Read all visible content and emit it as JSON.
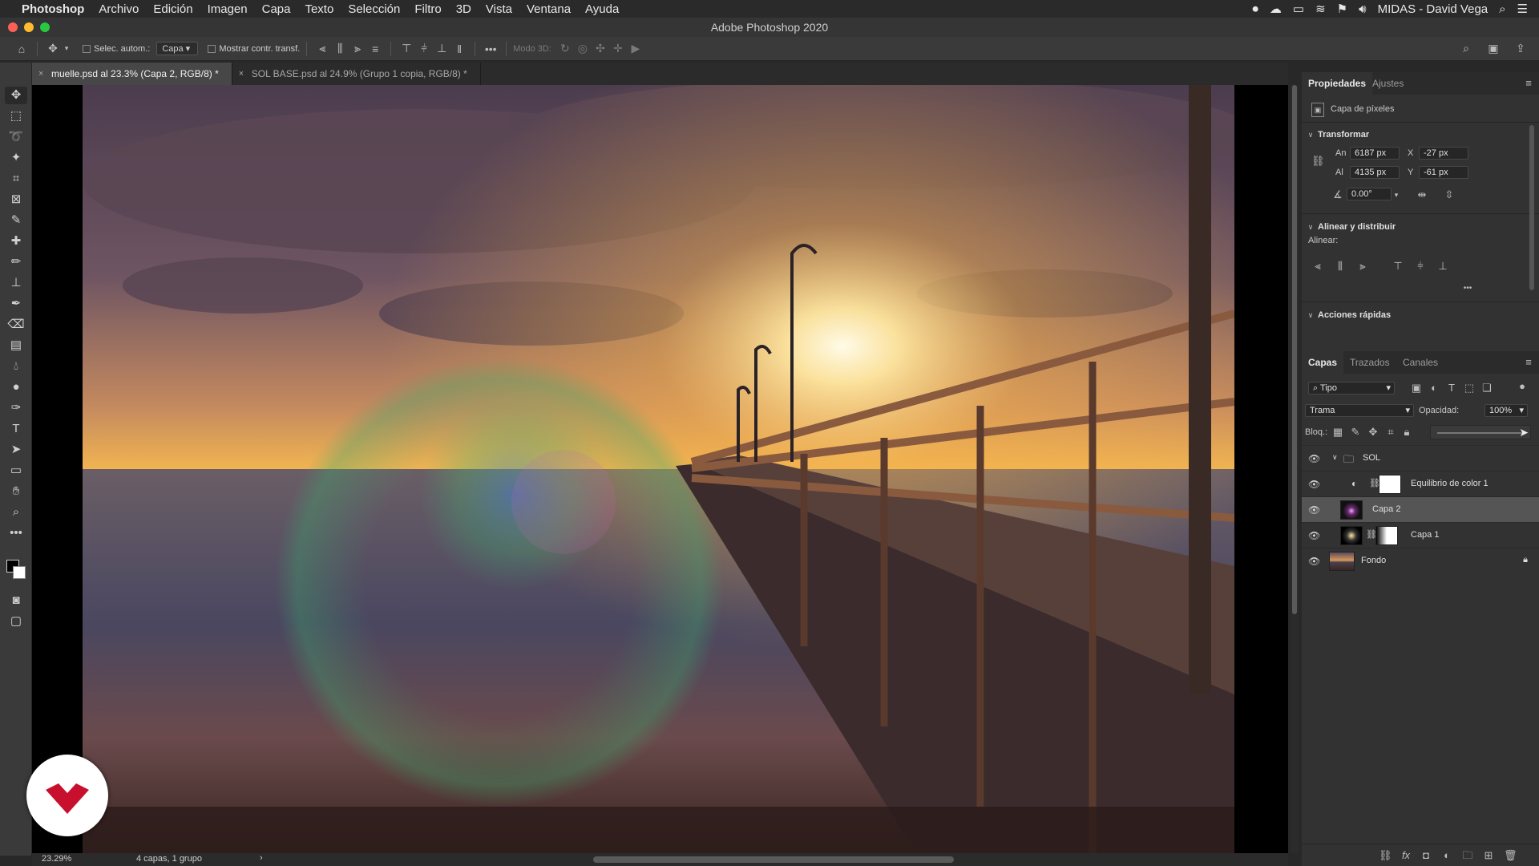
{
  "menubar": {
    "apple_icon": "apple-icon",
    "app_name": "Photoshop",
    "items": [
      "Archivo",
      "Edición",
      "Imagen",
      "Capa",
      "Texto",
      "Selección",
      "Filtro",
      "3D",
      "Vista",
      "Ventana",
      "Ayuda"
    ],
    "user": "MIDAS - David Vega"
  },
  "window": {
    "title": "Adobe Photoshop 2020"
  },
  "options_bar": {
    "auto_select_label": "Selec. autom.:",
    "auto_select_value": "Capa",
    "show_transform_label": "Mostrar contr. transf.",
    "mode3d_label": "Modo 3D:",
    "more": "•••"
  },
  "tabs": [
    {
      "close": "×",
      "label": "muelle.psd al 23.3% (Capa 2, RGB/8) *",
      "active": true
    },
    {
      "close": "×",
      "label": "SOL BASE.psd al 24.9% (Grupo 1 copia, RGB/8) *",
      "active": false
    }
  ],
  "status": {
    "zoom": "23.29%",
    "info": "4 capas, 1 grupo",
    "arrow": "›"
  },
  "properties": {
    "tab_props": "Propiedades",
    "tab_adjust": "Ajustes",
    "layer_type": "Capa de píxeles",
    "transform_title": "Transformar",
    "w_label": "An",
    "w_value": "6187 px",
    "h_label": "Al",
    "h_value": "4135 px",
    "x_label": "X",
    "x_value": "-27 px",
    "y_label": "Y",
    "y_value": "-61 px",
    "angle_value": "0.00°",
    "align_title": "Alinear y distribuir",
    "align_label": "Alinear:",
    "more": "•••",
    "quick_title": "Acciones rápidas"
  },
  "layers_panel": {
    "tab_layers": "Capas",
    "tab_paths": "Trazados",
    "tab_channels": "Canales",
    "filter_value": "Tipo",
    "blend_mode": "Trama",
    "opacity_label": "Opacidad:",
    "opacity_value": "100%",
    "lock_label": "Bloq.:",
    "layers": [
      {
        "name": "SOL",
        "kind": "group",
        "selected": false
      },
      {
        "name": "Equilibrio de color 1",
        "kind": "adjustment",
        "selected": false
      },
      {
        "name": "Capa 2",
        "kind": "pixel",
        "selected": true
      },
      {
        "name": "Capa 1",
        "kind": "masked",
        "selected": false
      },
      {
        "name": "Fondo",
        "kind": "background",
        "selected": false
      }
    ]
  },
  "colors": {
    "accent_logo": "#c8102e",
    "panel_bg": "#323232",
    "selected_layer": "#555555"
  }
}
